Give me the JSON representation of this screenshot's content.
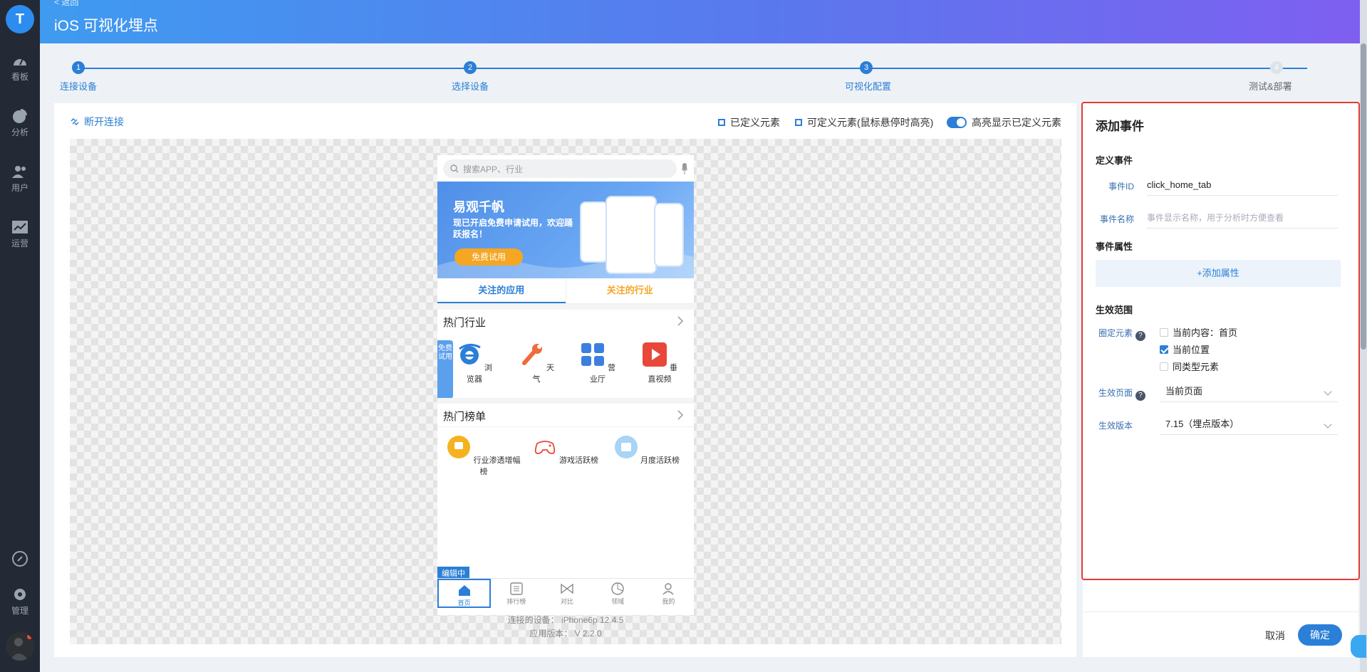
{
  "app": {
    "logo_letter": "T"
  },
  "sidebar": {
    "items": [
      {
        "label": "看板",
        "icon": "dashboard-icon"
      },
      {
        "label": "分析",
        "icon": "pie-chart-icon"
      },
      {
        "label": "用户",
        "icon": "users-icon"
      },
      {
        "label": "运营",
        "icon": "trend-icon"
      }
    ],
    "bottom": [
      {
        "label": "",
        "icon": "link-icon"
      },
      {
        "label": "管理",
        "icon": "gear-icon"
      }
    ]
  },
  "header": {
    "back": "< 返回",
    "title": "iOS 可视化埋点"
  },
  "steps": [
    {
      "num": "1",
      "label": "连接设备",
      "done": true
    },
    {
      "num": "2",
      "label": "选择设备",
      "done": true
    },
    {
      "num": "3",
      "label": "可视化配置",
      "done": true
    },
    {
      "num": "4",
      "label": "测试&部署",
      "done": false
    }
  ],
  "toolbar": {
    "disconnect": "断开连接",
    "legend_defined": "已定义元素",
    "legend_definable": "可定义元素(鼠标悬停时高亮)",
    "highlight_toggle": "高亮显示已定义元素"
  },
  "phone": {
    "search_placeholder": "搜索APP、行业",
    "banner": {
      "title": "易观千帆",
      "subtitle": "现已开启免费申请试用，欢迎踊跃报名！",
      "button": "免费试用"
    },
    "tabs": [
      "关注的应用",
      "关注的行业"
    ],
    "section1": {
      "title": "热门行业",
      "items": [
        {
          "label": "浏览器",
          "icon": "browser-icon"
        },
        {
          "label": "天气",
          "icon": "wrench-icon"
        },
        {
          "label": "营业厅",
          "icon": "grid-icon"
        },
        {
          "label": "垂直视频",
          "icon": "video-icon"
        }
      ]
    },
    "side_tag": "免费试用",
    "section2": {
      "title": "热门榜单",
      "items": [
        {
          "label": "行业渗透增幅榜",
          "icon": "trophy-icon"
        },
        {
          "label": "游戏活跃榜",
          "icon": "gamepad-icon"
        },
        {
          "label": "月度活跃榜",
          "icon": "calendar-icon"
        }
      ]
    },
    "edit_badge": "编辑中",
    "tabbar": [
      {
        "label": "首页",
        "icon": "home-icon",
        "active": true
      },
      {
        "label": "排行榜",
        "icon": "list-icon",
        "active": false
      },
      {
        "label": "对比",
        "icon": "compare-icon",
        "active": false
      },
      {
        "label": "领域",
        "icon": "domain-icon",
        "active": false
      },
      {
        "label": "我的",
        "icon": "user-icon",
        "active": false
      }
    ]
  },
  "device": {
    "connected": "连接的设备： iPhone6p 12.4.5",
    "app_version": "应用版本： V 2.2.0"
  },
  "panel": {
    "title": "添加事件",
    "define_section": "定义事件",
    "event_id_label": "事件ID",
    "event_id_value": "click_home_tab",
    "event_name_label": "事件名称",
    "event_name_placeholder": "事件显示名称，用于分析时方便查看",
    "props_section": "事件属性",
    "add_prop": "+添加属性",
    "scope_section": "生效范围",
    "scope_label": "圈定元素",
    "scope_options": [
      {
        "label": "当前内容：首页",
        "checked": false
      },
      {
        "label": "当前位置",
        "checked": true
      },
      {
        "label": "同类型元素",
        "checked": false
      }
    ],
    "page_label": "生效页面",
    "page_value": "当前页面",
    "version_label": "生效版本",
    "version_value": "7.15（埋点版本）",
    "cancel": "取消",
    "ok": "确定"
  },
  "colors": {
    "accent": "#2b7fd6",
    "highlight_border": "#e53935",
    "sidebar_bg": "#232a35"
  }
}
